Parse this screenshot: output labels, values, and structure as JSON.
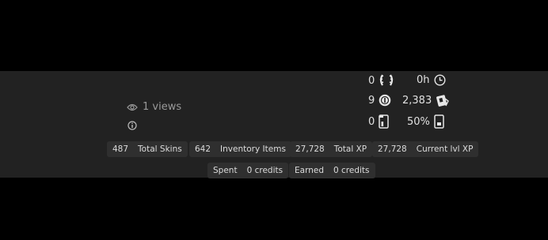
{
  "profile": {
    "views": "1 views"
  },
  "stats": {
    "awards": "0",
    "playtime": "0h",
    "coins": "9",
    "rare_value": "2,383",
    "phone_count": "0",
    "phone_percent": "50%"
  },
  "chips": [
    {
      "value": "487",
      "label": "Total Skins"
    },
    {
      "value": "642",
      "label": "Inventory Items"
    },
    {
      "value": "27,728",
      "label": "Total XP"
    },
    {
      "value": "27,728",
      "label": "Current lvl XP"
    }
  ],
  "credits": [
    {
      "value": "Spent",
      "label": "0 credits"
    },
    {
      "value": "Earned",
      "label": "0 credits"
    }
  ],
  "icons": [
    "eye-icon",
    "info-icon",
    "laurel-icon",
    "clock-icon",
    "coin-icon",
    "tag-icon",
    "phone-icon",
    "phone-outline-icon"
  ],
  "colors": {
    "background": "#000000",
    "panel": "#222222",
    "chip": "#2f2f2f",
    "text": "#e0e0e0",
    "muted": "#9a9a9a"
  }
}
